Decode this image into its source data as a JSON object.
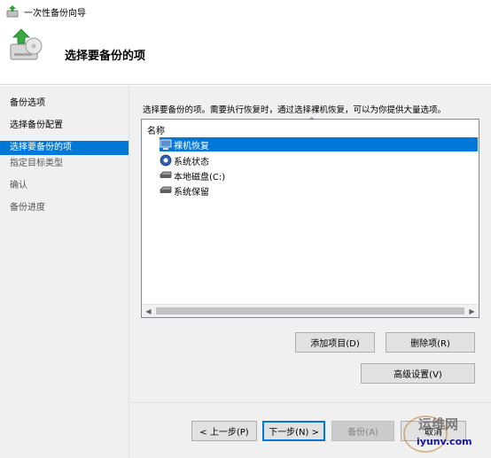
{
  "window": {
    "title": "一次性备份向导",
    "heading": "选择要备份的项"
  },
  "nav": {
    "items": [
      {
        "label": "备份选项",
        "state": "normal"
      },
      {
        "label": "选择备份配置",
        "state": "normal"
      },
      {
        "label": "选择要备份的项",
        "state": "active"
      },
      {
        "label": "指定目标类型",
        "state": "disabled"
      },
      {
        "label": "确认",
        "state": "disabled"
      },
      {
        "label": "备份进度",
        "state": "disabled"
      }
    ]
  },
  "main": {
    "instruction": "选择要备份的项。需要执行恢复时，通过选择裸机恢复，可以为你提供大量选项。",
    "list": {
      "column_header": "名称",
      "items": [
        {
          "label": "裸机恢复",
          "icon": "bare-metal-icon",
          "selected": true
        },
        {
          "label": "系统状态",
          "icon": "system-state-icon",
          "selected": false
        },
        {
          "label": "本地磁盘(C:)",
          "icon": "disk-icon",
          "selected": false
        },
        {
          "label": "系统保留",
          "icon": "disk-icon",
          "selected": false
        }
      ]
    },
    "buttons": {
      "add": "添加项目(D)",
      "remove": "删除项(R)",
      "advanced": "高级设置(V)"
    }
  },
  "footer": {
    "back": "< 上一步(P)",
    "next": "下一步(N) >",
    "backup": "备份(A)",
    "cancel": "取消"
  },
  "watermark": {
    "top": "运维网",
    "bottom": "iyunv.com"
  },
  "colors": {
    "accent": "#0078d7",
    "background": "#f0f0f0"
  }
}
